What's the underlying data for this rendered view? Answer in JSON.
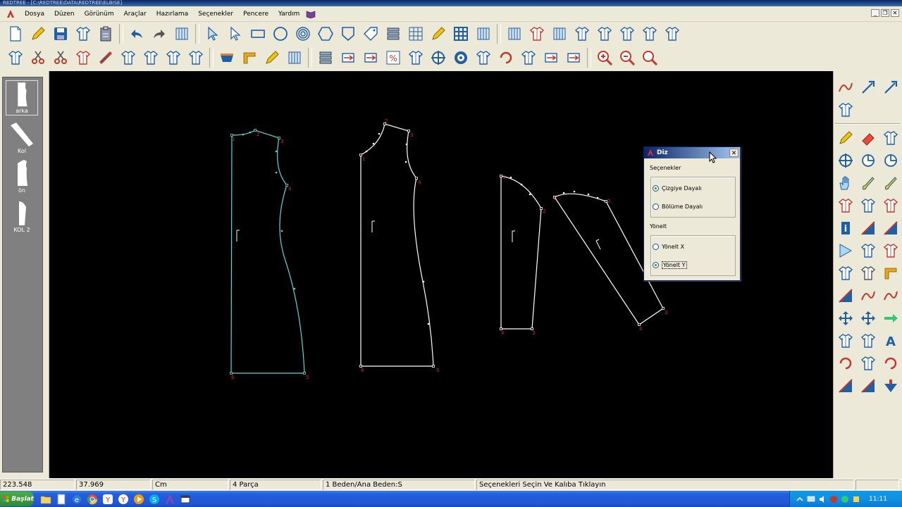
{
  "app": {
    "title_bar_text": "REDTREE - [C:\\REDTREE\\DATA\\REDTREE\\ELBISE]"
  },
  "menu": [
    "Dosya",
    "Düzen",
    "Görünüm",
    "Araçlar",
    "Hazırlama",
    "Seçenekler",
    "Pencere",
    "Yardım"
  ],
  "mdi_buttons": {
    "minimize": "_",
    "restore": "❐",
    "close": "✕"
  },
  "toolbar_top": [
    "new-file-icon",
    "open-file-icon",
    "save-icon",
    "shirt-icon",
    "clipboard-icon",
    "undo-icon",
    "redo-icon",
    "import-icon",
    "select-arrow-icon",
    "arrow-outline-icon",
    "rectangle-icon",
    "circle-icon",
    "spiral-icon",
    "hexagon-icon",
    "shield-shape-icon",
    "tag-icon",
    "stack-icon",
    "grid-icon",
    "pen-icon",
    "grid-bold-icon",
    "jacket-icon",
    "marker-icon",
    "cut-shirt-icon",
    "pleat-icon",
    "shirt-split-icon",
    "bodice-icon",
    "dart-bodice-icon",
    "garment-icon",
    "shirt-small-icon"
  ],
  "toolbar_bottom": [
    "shirt-measure-icon",
    "scissor-red-icon",
    "scissor-blue-icon",
    "shirt-cut-icon",
    "ruler-stripes-icon",
    "shirt-flip-icon",
    "shirt-fold-icon",
    "shirt-mirror-icon",
    "shirt-arrow-icon",
    "bucket-icon",
    "corner-icon",
    "pencil-icon",
    "sewing-icon",
    "printer-icon",
    "move-left-icon",
    "grade-icon",
    "percent-icon",
    "scale-icon",
    "crosshair-icon",
    "target-icon",
    "shirt-up-icon",
    "shirt-rotate-icon",
    "shirt-diagonal-icon",
    "box-flip-icon",
    "box-arrow-icon",
    "zoom-in-icon",
    "zoom-out-icon",
    "zoom-fit-icon"
  ],
  "pieces_panel": [
    {
      "label": "arka",
      "selected": true
    },
    {
      "label": "Kol",
      "selected": false
    },
    {
      "label": "ön",
      "selected": false
    },
    {
      "label": "KOL 2",
      "selected": false
    }
  ],
  "canvas": {
    "piece_colors": {
      "selected": "#5fd6d6",
      "normal": "#ffffff",
      "number_color": "#e02020"
    },
    "pieces": [
      {
        "name": "arka",
        "corner_numbers": [
          "1",
          "2",
          "3",
          "4",
          "5",
          "6"
        ]
      },
      {
        "name": "ön",
        "corner_numbers": [
          "1",
          "2",
          "3",
          "4",
          "5",
          "6"
        ]
      },
      {
        "name": "Kol",
        "corner_numbers": [
          "1",
          "2",
          "3",
          "4"
        ]
      },
      {
        "name": "KOL 2",
        "corner_numbers": [
          "1",
          "2",
          "3",
          "4"
        ]
      }
    ]
  },
  "dialog": {
    "title": "Diz",
    "close": "✕",
    "section1": "Seçenekler",
    "options1": [
      {
        "label": "Çizgiye Dayalı",
        "checked": true
      },
      {
        "label": "Bölüme Dayalı",
        "checked": false
      }
    ],
    "section2": "Yönelt",
    "options2": [
      {
        "label": "Yönelt X",
        "checked": false
      },
      {
        "label": "Yönelt Y",
        "checked": true
      }
    ]
  },
  "right_toolbar": [
    "arrow-curve-icon",
    "pin-arrow-icon",
    "pin-arrow2-icon",
    "shirt-plus-icon",
    "curve-pen-icon",
    "eraser-icon",
    "shirt-line-icon",
    "circle-cross-icon",
    "notch-icon",
    "notch-plus-icon",
    "hand-icon",
    "brush-icon",
    "paint-brush-icon",
    "shirt-mark-icon",
    "shirt-sew-icon",
    "shirt-mark2-icon",
    "info-shirt-icon",
    "triangle-split-icon",
    "triangle-fold-icon",
    "flag-icon",
    "shirt-blue-icon",
    "shirt-red-icon",
    "shirt-pattern-icon",
    "shirt-gray-icon",
    "shirt-corner-icon",
    "triangle-red-icon",
    "wave-icon",
    "curve-icon",
    "move-cross-icon",
    "move-cross2-icon",
    "arrow-right-icon",
    "shirt-a-icon",
    "shirt-b-icon",
    "text-a-icon",
    "rotate-ccw-icon",
    "shirt-c-icon",
    "rotate-cw-icon",
    "triangle-a-icon",
    "triangle-b-icon",
    "arrow-down-icon"
  ],
  "status": {
    "x": "223.548",
    "y": "37.969",
    "unit": "Cm",
    "pieces": "4 Parça",
    "size": "1 Beden/Ana Beden:S",
    "message": "Seçenekleri Seçin Ve Kalıba Tıklayın"
  },
  "taskbar": {
    "start_label": "Başlat",
    "clock": "11:11"
  }
}
